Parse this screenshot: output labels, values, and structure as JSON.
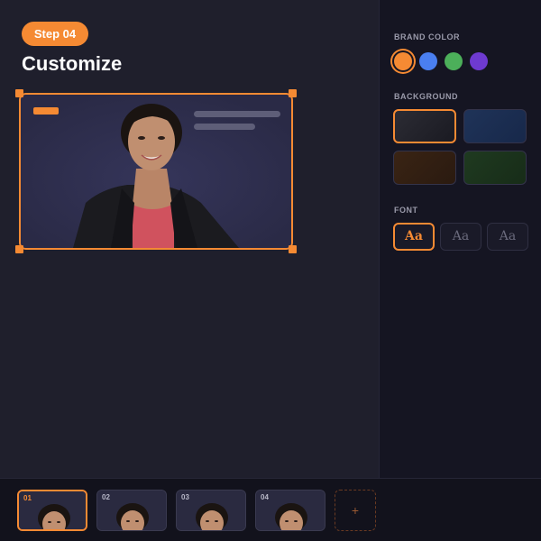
{
  "header": {
    "step_badge": "Step 04",
    "title": "Customize"
  },
  "canvas": {
    "logo_color": "#f58a33",
    "frame_border_color": "#f58a33"
  },
  "sidebar": {
    "brand_color": {
      "label": "BRAND COLOR",
      "swatches": [
        {
          "name": "orange",
          "color": "#f58a33",
          "selected": true
        },
        {
          "name": "blue",
          "color": "#4a7ff0",
          "selected": false
        },
        {
          "name": "green",
          "color": "#4caf5a",
          "selected": false
        },
        {
          "name": "purple",
          "color": "#6e3ad0",
          "selected": false
        }
      ]
    },
    "background": {
      "label": "BACKGROUND",
      "options": [
        {
          "name": "dark-slate",
          "selected": true
        },
        {
          "name": "navy",
          "selected": false
        },
        {
          "name": "brown",
          "selected": false
        },
        {
          "name": "forest",
          "selected": false
        }
      ]
    },
    "font": {
      "label": "FONT",
      "options": [
        "Aa",
        "Aa",
        "Aa"
      ],
      "selected_index": 0
    }
  },
  "timeline": {
    "scenes": [
      {
        "number": "01",
        "selected": true
      },
      {
        "number": "02",
        "selected": false
      },
      {
        "number": "03",
        "selected": false
      },
      {
        "number": "04",
        "selected": false
      }
    ],
    "add_label": "+"
  }
}
